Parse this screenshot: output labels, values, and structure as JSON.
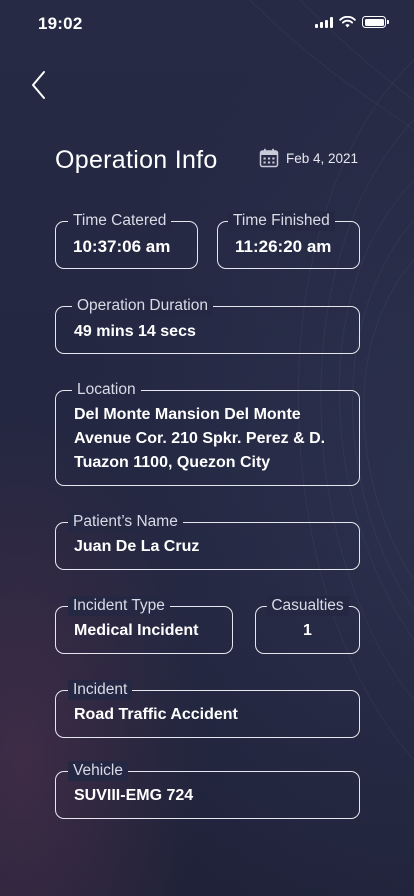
{
  "status_bar": {
    "time": "19:02",
    "icons": [
      "cellular-signal-icon",
      "wifi-icon",
      "battery-icon"
    ]
  },
  "nav": {
    "back_icon": "chevron-left-icon"
  },
  "header": {
    "title": "Operation Info",
    "date_icon": "calendar-icon",
    "date": "Feb 4, 2021"
  },
  "fields": {
    "time_catered": {
      "label": "Time Catered",
      "value": "10:37:06 am"
    },
    "time_finished": {
      "label": "Time Finished",
      "value": "11:26:20 am"
    },
    "operation_duration": {
      "label": "Operation Duration",
      "value": "49 mins 14 secs"
    },
    "location": {
      "label": "Location",
      "value": "Del Monte Mansion Del Monte Avenue Cor. 210 Spkr. Perez & D. Tuazon 1100, Quezon City"
    },
    "patient_name": {
      "label": "Patient’s Name",
      "value": "Juan De La Cruz"
    },
    "incident_type": {
      "label": "Incident Type",
      "value": "Medical Incident"
    },
    "casualties": {
      "label": "Casualties",
      "value": "1"
    },
    "incident": {
      "label": "Incident",
      "value": "Road Traffic Accident"
    },
    "vehicle": {
      "label": "Vehicle",
      "value": "SUVIII-EMG 724"
    }
  },
  "colors": {
    "background": "#242842",
    "border": "#e6e7ee",
    "text": "#ffffff",
    "label_text": "#d9dbe6"
  }
}
